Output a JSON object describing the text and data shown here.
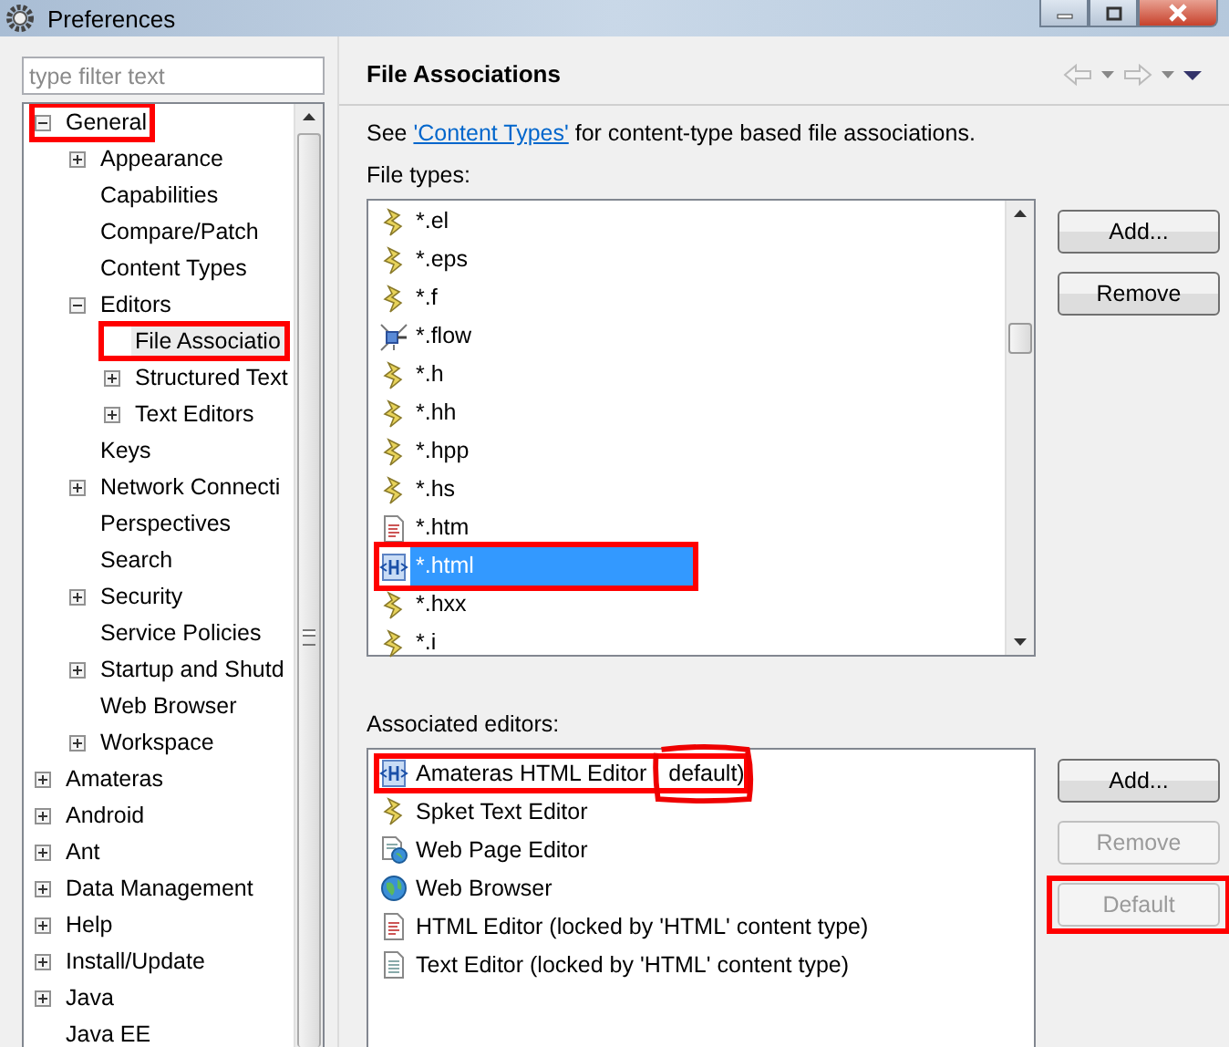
{
  "window": {
    "title": "Preferences"
  },
  "filter": {
    "placeholder": "type filter text"
  },
  "tree": [
    {
      "label": "General",
      "expanded": true,
      "selected": false,
      "highlighted": true,
      "children": [
        {
          "label": "Appearance",
          "expanded": false,
          "selected": false,
          "highlighted": false
        },
        {
          "label": "Capabilities",
          "selected": false,
          "highlighted": false
        },
        {
          "label": "Compare/Patch",
          "selected": false,
          "highlighted": false
        },
        {
          "label": "Content Types",
          "selected": false,
          "highlighted": false
        },
        {
          "label": "Editors",
          "expanded": true,
          "selected": false,
          "highlighted": false,
          "children": [
            {
              "label": "File Associatio",
              "selected": true,
              "highlighted": true
            },
            {
              "label": "Structured Text",
              "expanded": false,
              "selected": false,
              "highlighted": false
            },
            {
              "label": "Text Editors",
              "expanded": false,
              "selected": false,
              "highlighted": false
            }
          ]
        },
        {
          "label": "Keys",
          "selected": false,
          "highlighted": false
        },
        {
          "label": "Network Connecti",
          "expanded": false,
          "selected": false,
          "highlighted": false
        },
        {
          "label": "Perspectives",
          "selected": false,
          "highlighted": false
        },
        {
          "label": "Search",
          "selected": false,
          "highlighted": false
        },
        {
          "label": "Security",
          "expanded": false,
          "selected": false,
          "highlighted": false
        },
        {
          "label": "Service Policies",
          "selected": false,
          "highlighted": false
        },
        {
          "label": "Startup and Shutd",
          "expanded": false,
          "selected": false,
          "highlighted": false
        },
        {
          "label": "Web Browser",
          "selected": false,
          "highlighted": false
        },
        {
          "label": "Workspace",
          "expanded": false,
          "selected": false,
          "highlighted": false
        }
      ]
    },
    {
      "label": "Amateras",
      "expanded": false,
      "selected": false,
      "highlighted": false
    },
    {
      "label": "Android",
      "expanded": false,
      "selected": false,
      "highlighted": false
    },
    {
      "label": "Ant",
      "expanded": false,
      "selected": false,
      "highlighted": false
    },
    {
      "label": "Data Management",
      "expanded": false,
      "selected": false,
      "highlighted": false
    },
    {
      "label": "Help",
      "expanded": false,
      "selected": false,
      "highlighted": false
    },
    {
      "label": "Install/Update",
      "expanded": false,
      "selected": false,
      "highlighted": false
    },
    {
      "label": "Java",
      "expanded": false,
      "selected": false,
      "highlighted": false
    },
    {
      "label": "Java EE",
      "selected": false,
      "highlighted": false
    }
  ],
  "page": {
    "title": "File Associations",
    "intro_before": "See",
    "link": "'Content Types'",
    "intro_after": "for content-type based file associations."
  },
  "file_types": {
    "label": "File types:",
    "items": [
      {
        "name": "*.el",
        "kind": "spket",
        "selected": false,
        "highlighted": false
      },
      {
        "name": "*.eps",
        "kind": "spket",
        "selected": false,
        "highlighted": false
      },
      {
        "name": "*.f",
        "kind": "spket",
        "selected": false,
        "highlighted": false
      },
      {
        "name": "*.flow",
        "kind": "flow",
        "selected": false,
        "highlighted": false
      },
      {
        "name": "*.h",
        "kind": "spket",
        "selected": false,
        "highlighted": false
      },
      {
        "name": "*.hh",
        "kind": "spket",
        "selected": false,
        "highlighted": false
      },
      {
        "name": "*.hpp",
        "kind": "spket",
        "selected": false,
        "highlighted": false
      },
      {
        "name": "*.hs",
        "kind": "spket",
        "selected": false,
        "highlighted": false
      },
      {
        "name": "*.htm",
        "kind": "htmldoc",
        "selected": false,
        "highlighted": false
      },
      {
        "name": "*.html",
        "kind": "html",
        "selected": true,
        "highlighted": true
      },
      {
        "name": "*.hxx",
        "kind": "spket",
        "selected": false,
        "highlighted": false
      },
      {
        "name": "*.i",
        "kind": "spket",
        "selected": false,
        "highlighted": false
      }
    ],
    "buttons": [
      {
        "label": "Add...",
        "disabled": false,
        "highlighted": false
      },
      {
        "label": "Remove",
        "disabled": false,
        "highlighted": false
      }
    ]
  },
  "editors": {
    "label": "Associated editors:",
    "items": [
      {
        "name": "Amateras HTML Editor",
        "note": "default)",
        "kind": "html",
        "highlighted": true,
        "scribbled": true
      },
      {
        "name": "Spket Text Editor",
        "kind": "spket",
        "highlighted": false,
        "scribbled": false
      },
      {
        "name": "Web Page Editor",
        "kind": "webpage",
        "highlighted": false,
        "scribbled": false
      },
      {
        "name": "Web Browser",
        "kind": "globe",
        "highlighted": false,
        "scribbled": false
      },
      {
        "name": "HTML Editor (locked by 'HTML' content type)",
        "kind": "htmldoc",
        "highlighted": false,
        "scribbled": false
      },
      {
        "name": "Text Editor (locked by 'HTML' content type)",
        "kind": "text",
        "highlighted": false,
        "scribbled": false
      }
    ],
    "buttons": [
      {
        "label": "Add...",
        "disabled": false,
        "highlighted": false
      },
      {
        "label": "Remove",
        "disabled": true,
        "highlighted": false
      },
      {
        "label": "Default",
        "disabled": true,
        "highlighted": true
      }
    ]
  }
}
